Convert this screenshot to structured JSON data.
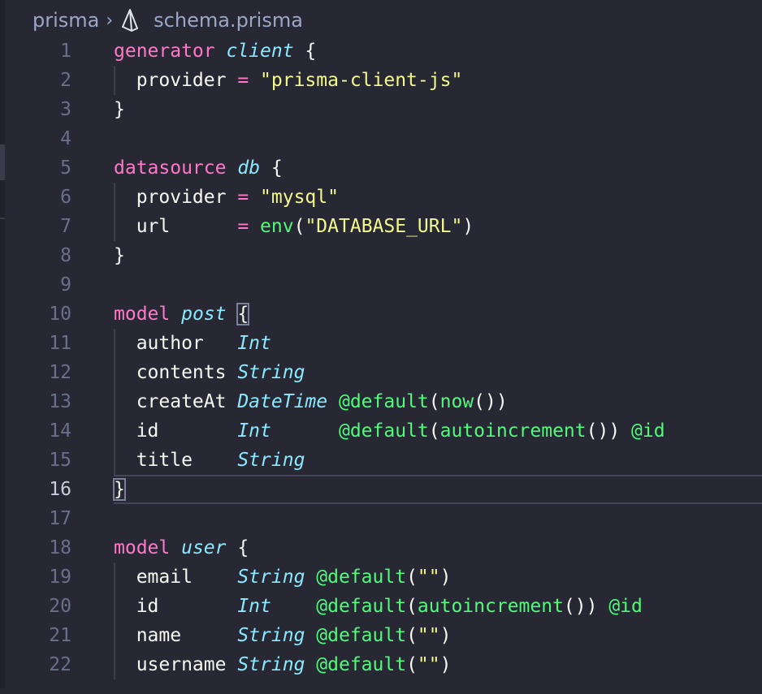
{
  "breadcrumb": {
    "folder": "prisma",
    "separator": "›",
    "file": "schema.prisma",
    "file_icon": "prisma-icon"
  },
  "colors": {
    "background": "#272834",
    "keyword": "#ff79c6",
    "type": "#8be9fd",
    "string": "#f1fa8c",
    "attribute": "#50fa7b",
    "text": "#f8f8f2",
    "line_number": "#6b6f8a"
  },
  "active_line": 16,
  "lines": [
    {
      "n": "1",
      "tokens": [
        [
          "kw",
          "generator"
        ],
        [
          "t",
          " "
        ],
        [
          "nm",
          "client"
        ],
        [
          "t",
          " {"
        ]
      ]
    },
    {
      "n": "2",
      "tokens": [
        [
          "t",
          "  provider "
        ],
        [
          "op",
          "="
        ],
        [
          "t",
          " "
        ],
        [
          "str",
          "\"prisma-client-js\""
        ]
      ]
    },
    {
      "n": "3",
      "tokens": [
        [
          "t",
          "}"
        ]
      ]
    },
    {
      "n": "4",
      "tokens": []
    },
    {
      "n": "5",
      "tokens": [
        [
          "kw",
          "datasource"
        ],
        [
          "t",
          " "
        ],
        [
          "nm",
          "db"
        ],
        [
          "t",
          " {"
        ]
      ]
    },
    {
      "n": "6",
      "tokens": [
        [
          "t",
          "  provider "
        ],
        [
          "op",
          "="
        ],
        [
          "t",
          " "
        ],
        [
          "str",
          "\"mysql\""
        ]
      ]
    },
    {
      "n": "7",
      "tokens": [
        [
          "t",
          "  url      "
        ],
        [
          "op",
          "="
        ],
        [
          "t",
          " "
        ],
        [
          "fn",
          "env"
        ],
        [
          "t",
          "("
        ],
        [
          "str",
          "\"DATABASE_URL\""
        ],
        [
          "t",
          ")"
        ]
      ]
    },
    {
      "n": "8",
      "tokens": [
        [
          "t",
          "}"
        ]
      ]
    },
    {
      "n": "9",
      "tokens": []
    },
    {
      "n": "10",
      "tokens": [
        [
          "kw",
          "model"
        ],
        [
          "t",
          " "
        ],
        [
          "nm",
          "post"
        ],
        [
          "t",
          " "
        ],
        [
          "br",
          "{"
        ]
      ]
    },
    {
      "n": "11",
      "tokens": [
        [
          "t",
          "  author   "
        ],
        [
          "ty",
          "Int"
        ]
      ]
    },
    {
      "n": "12",
      "tokens": [
        [
          "t",
          "  contents "
        ],
        [
          "ty",
          "String"
        ]
      ]
    },
    {
      "n": "13",
      "tokens": [
        [
          "t",
          "  createAt "
        ],
        [
          "ty",
          "DateTime"
        ],
        [
          "t",
          " "
        ],
        [
          "attr",
          "@default"
        ],
        [
          "t",
          "("
        ],
        [
          "fn",
          "now"
        ],
        [
          "t",
          "())"
        ]
      ]
    },
    {
      "n": "14",
      "tokens": [
        [
          "t",
          "  id       "
        ],
        [
          "ty",
          "Int"
        ],
        [
          "t",
          "      "
        ],
        [
          "attr",
          "@default"
        ],
        [
          "t",
          "("
        ],
        [
          "fn",
          "autoincrement"
        ],
        [
          "t",
          "()) "
        ],
        [
          "attr",
          "@id"
        ]
      ]
    },
    {
      "n": "15",
      "tokens": [
        [
          "t",
          "  title    "
        ],
        [
          "ty",
          "String"
        ]
      ]
    },
    {
      "n": "16",
      "tokens": [
        [
          "br",
          "}"
        ]
      ]
    },
    {
      "n": "17",
      "tokens": []
    },
    {
      "n": "18",
      "tokens": [
        [
          "kw",
          "model"
        ],
        [
          "t",
          " "
        ],
        [
          "nm",
          "user"
        ],
        [
          "t",
          " {"
        ]
      ]
    },
    {
      "n": "19",
      "tokens": [
        [
          "t",
          "  email    "
        ],
        [
          "ty",
          "String"
        ],
        [
          "t",
          " "
        ],
        [
          "attr",
          "@default"
        ],
        [
          "t",
          "("
        ],
        [
          "str",
          "\"\""
        ],
        [
          "t",
          ")"
        ]
      ]
    },
    {
      "n": "20",
      "tokens": [
        [
          "t",
          "  id       "
        ],
        [
          "ty",
          "Int"
        ],
        [
          "t",
          "    "
        ],
        [
          "attr",
          "@default"
        ],
        [
          "t",
          "("
        ],
        [
          "fn",
          "autoincrement"
        ],
        [
          "t",
          "()) "
        ],
        [
          "attr",
          "@id"
        ]
      ]
    },
    {
      "n": "21",
      "tokens": [
        [
          "t",
          "  name     "
        ],
        [
          "ty",
          "String"
        ],
        [
          "t",
          " "
        ],
        [
          "attr",
          "@default"
        ],
        [
          "t",
          "("
        ],
        [
          "str",
          "\"\""
        ],
        [
          "t",
          ")"
        ]
      ]
    },
    {
      "n": "22",
      "tokens": [
        [
          "t",
          "  username "
        ],
        [
          "ty",
          "String"
        ],
        [
          "t",
          " "
        ],
        [
          "attr",
          "@default"
        ],
        [
          "t",
          "("
        ],
        [
          "str",
          "\"\""
        ],
        [
          "t",
          ")"
        ]
      ]
    }
  ]
}
